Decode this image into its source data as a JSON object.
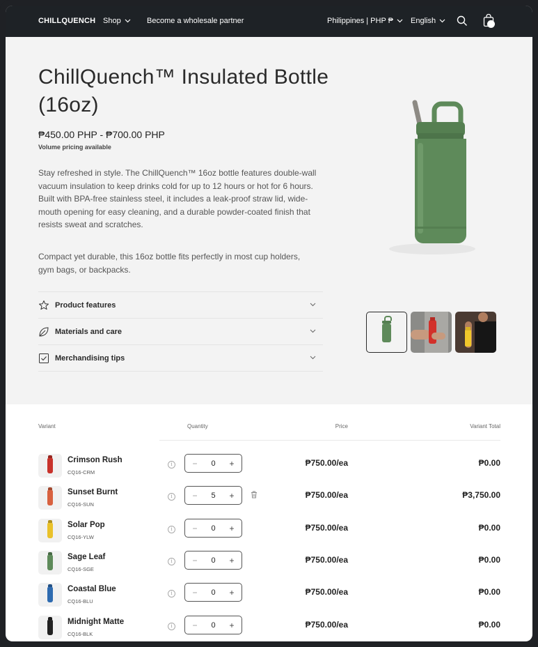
{
  "header": {
    "logo": "CHILLQUENCH",
    "shop": "Shop",
    "wholesale": "Become a wholesale partner",
    "country": "Philippines | PHP ₱",
    "language": "English"
  },
  "product": {
    "title": "ChillQuench™ Insulated Bottle (16oz)",
    "price_range": "₱450.00 PHP - ₱700.00 PHP",
    "volume_note": "Volume pricing available",
    "description": "Stay refreshed in style. The ChillQuench™ 16oz bottle features double-wall vacuum insulation to keep drinks cold for up to 12 hours or hot for 6 hours. Built with BPA-free stainless steel, it includes a leak-proof straw lid, wide-mouth opening for easy cleaning, and a durable powder-coated finish that resists sweat and scratches.",
    "description2": "Compact yet durable, this 16oz bottle fits perfectly in most cup holders, gym bags, or backpacks.",
    "accordion": [
      {
        "label": "Product features",
        "icon": "star-icon"
      },
      {
        "label": "Materials and care",
        "icon": "leaf-icon"
      },
      {
        "label": "Merchandising tips",
        "icon": "checkbox-icon"
      }
    ]
  },
  "table": {
    "headers": {
      "variant": "Variant",
      "quantity": "Quantity",
      "price": "Price",
      "total": "Variant Total"
    },
    "rows": [
      {
        "name": "Crimson Rush",
        "sku": "CQ16-CRM",
        "qty": "0",
        "price": "₱750.00/ea",
        "total": "₱0.00",
        "color": "#c8322b",
        "trash": false
      },
      {
        "name": "Sunset Burnt",
        "sku": "CQ16-SUN",
        "qty": "5",
        "price": "₱750.00/ea",
        "total": "₱3,750.00",
        "color": "#d8613f",
        "trash": true
      },
      {
        "name": "Solar Pop",
        "sku": "CQ16-YLW",
        "qty": "0",
        "price": "₱750.00/ea",
        "total": "₱0.00",
        "color": "#e9c12a",
        "trash": false
      },
      {
        "name": "Sage Leaf",
        "sku": "CQ16-SGE",
        "qty": "0",
        "price": "₱750.00/ea",
        "total": "₱0.00",
        "color": "#5e8a5a",
        "trash": false
      },
      {
        "name": "Coastal Blue",
        "sku": "CQ16-BLU",
        "qty": "0",
        "price": "₱750.00/ea",
        "total": "₱0.00",
        "color": "#2e6bb0",
        "trash": false
      },
      {
        "name": "Midnight Matte",
        "sku": "CQ16-BLK",
        "qty": "0",
        "price": "₱750.00/ea",
        "total": "₱0.00",
        "color": "#222222",
        "trash": false
      }
    ]
  },
  "colors": {
    "header_bg": "#1e2226",
    "hero_bg": "#f3f3f3",
    "bottle_green": "#5e8a5a"
  }
}
